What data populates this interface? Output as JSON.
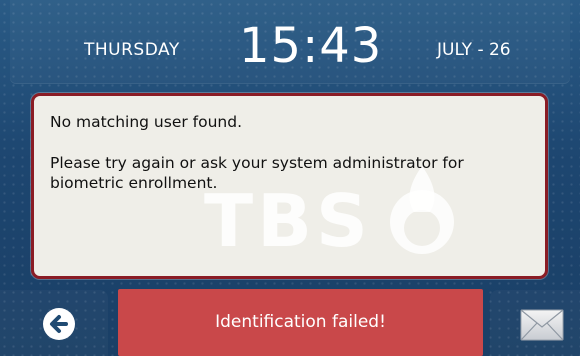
{
  "header": {
    "day": "THURSDAY",
    "time": "15:43",
    "date": "JULY - 26"
  },
  "message": {
    "line1": "No matching user found.",
    "line2": "Please try again or ask your system administrator for biometric enrollment.",
    "watermark_text": "TBS"
  },
  "footer": {
    "status": "Identification failed!",
    "back_icon": "arrow-left-circle-icon",
    "mail_icon": "envelope-icon"
  },
  "colors": {
    "background": "#1f4a72",
    "panel": "#efeee8",
    "panel_border": "#8a1c25",
    "status_bar": "#c9484a"
  }
}
